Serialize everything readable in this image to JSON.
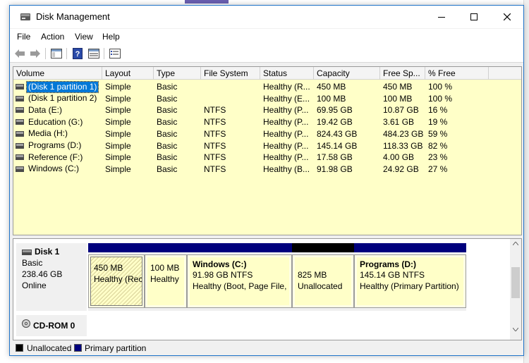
{
  "window": {
    "title": "Disk Management",
    "controls": {
      "minimize": "minimize",
      "maximize": "maximize",
      "close": "close"
    }
  },
  "menu": [
    "File",
    "Action",
    "View",
    "Help"
  ],
  "toolbar": {
    "icons": [
      "back-arrow-icon",
      "forward-arrow-icon",
      "console-tree-icon",
      "help-icon",
      "properties-icon",
      "list-view-icon"
    ]
  },
  "volume_table": {
    "columns": [
      "Volume",
      "Layout",
      "Type",
      "File System",
      "Status",
      "Capacity",
      "Free Sp...",
      "% Free"
    ],
    "rows": [
      {
        "volume": "(Disk 1 partition 1)",
        "layout": "Simple",
        "type": "Basic",
        "fs": "",
        "status": "Healthy (R...",
        "capacity": "450 MB",
        "free": "450 MB",
        "pct": "100 %",
        "selected": true
      },
      {
        "volume": "(Disk 1 partition 2)",
        "layout": "Simple",
        "type": "Basic",
        "fs": "",
        "status": "Healthy (E...",
        "capacity": "100 MB",
        "free": "100 MB",
        "pct": "100 %"
      },
      {
        "volume": "Data (E:)",
        "layout": "Simple",
        "type": "Basic",
        "fs": "NTFS",
        "status": "Healthy (P...",
        "capacity": "69.95 GB",
        "free": "10.87 GB",
        "pct": "16 %"
      },
      {
        "volume": "Education (G:)",
        "layout": "Simple",
        "type": "Basic",
        "fs": "NTFS",
        "status": "Healthy (P...",
        "capacity": "19.42 GB",
        "free": "3.61 GB",
        "pct": "19 %"
      },
      {
        "volume": "Media (H:)",
        "layout": "Simple",
        "type": "Basic",
        "fs": "NTFS",
        "status": "Healthy (P...",
        "capacity": "824.43 GB",
        "free": "484.23 GB",
        "pct": "59 %"
      },
      {
        "volume": "Programs (D:)",
        "layout": "Simple",
        "type": "Basic",
        "fs": "NTFS",
        "status": "Healthy (P...",
        "capacity": "145.14 GB",
        "free": "118.33 GB",
        "pct": "82 %"
      },
      {
        "volume": "Reference (F:)",
        "layout": "Simple",
        "type": "Basic",
        "fs": "NTFS",
        "status": "Healthy (P...",
        "capacity": "17.58 GB",
        "free": "4.00 GB",
        "pct": "23 %"
      },
      {
        "volume": "Windows (C:)",
        "layout": "Simple",
        "type": "Basic",
        "fs": "NTFS",
        "status": "Healthy (B...",
        "capacity": "91.98 GB",
        "free": "24.92 GB",
        "pct": "27 %"
      }
    ]
  },
  "disk_map": {
    "disk": {
      "name": "Disk 1",
      "type": "Basic",
      "size": "238.46 GB",
      "state": "Online"
    },
    "partitions": [
      {
        "title": "",
        "line1": "450 MB",
        "line2": "Healthy (Rec",
        "hatched": true
      },
      {
        "title": "",
        "line1": "100 MB",
        "line2": "Healthy",
        "hatched": false
      },
      {
        "title": "Windows  (C:)",
        "line1": "91.98 GB NTFS",
        "line2": "Healthy (Boot, Page File, C",
        "hatched": false
      },
      {
        "title": "",
        "line1": "825 MB",
        "line2": "Unallocated",
        "hatched": false,
        "unallocated": true
      },
      {
        "title": "Programs  (D:)",
        "line1": "145.14 GB NTFS",
        "line2": "Healthy (Primary Partition)",
        "hatched": false
      }
    ],
    "cdrom": "CD-ROM 0"
  },
  "legend": {
    "unallocated": "Unallocated",
    "primary": "Primary partition",
    "colors": {
      "unallocated": "#000000",
      "primary": "#00007d"
    }
  }
}
